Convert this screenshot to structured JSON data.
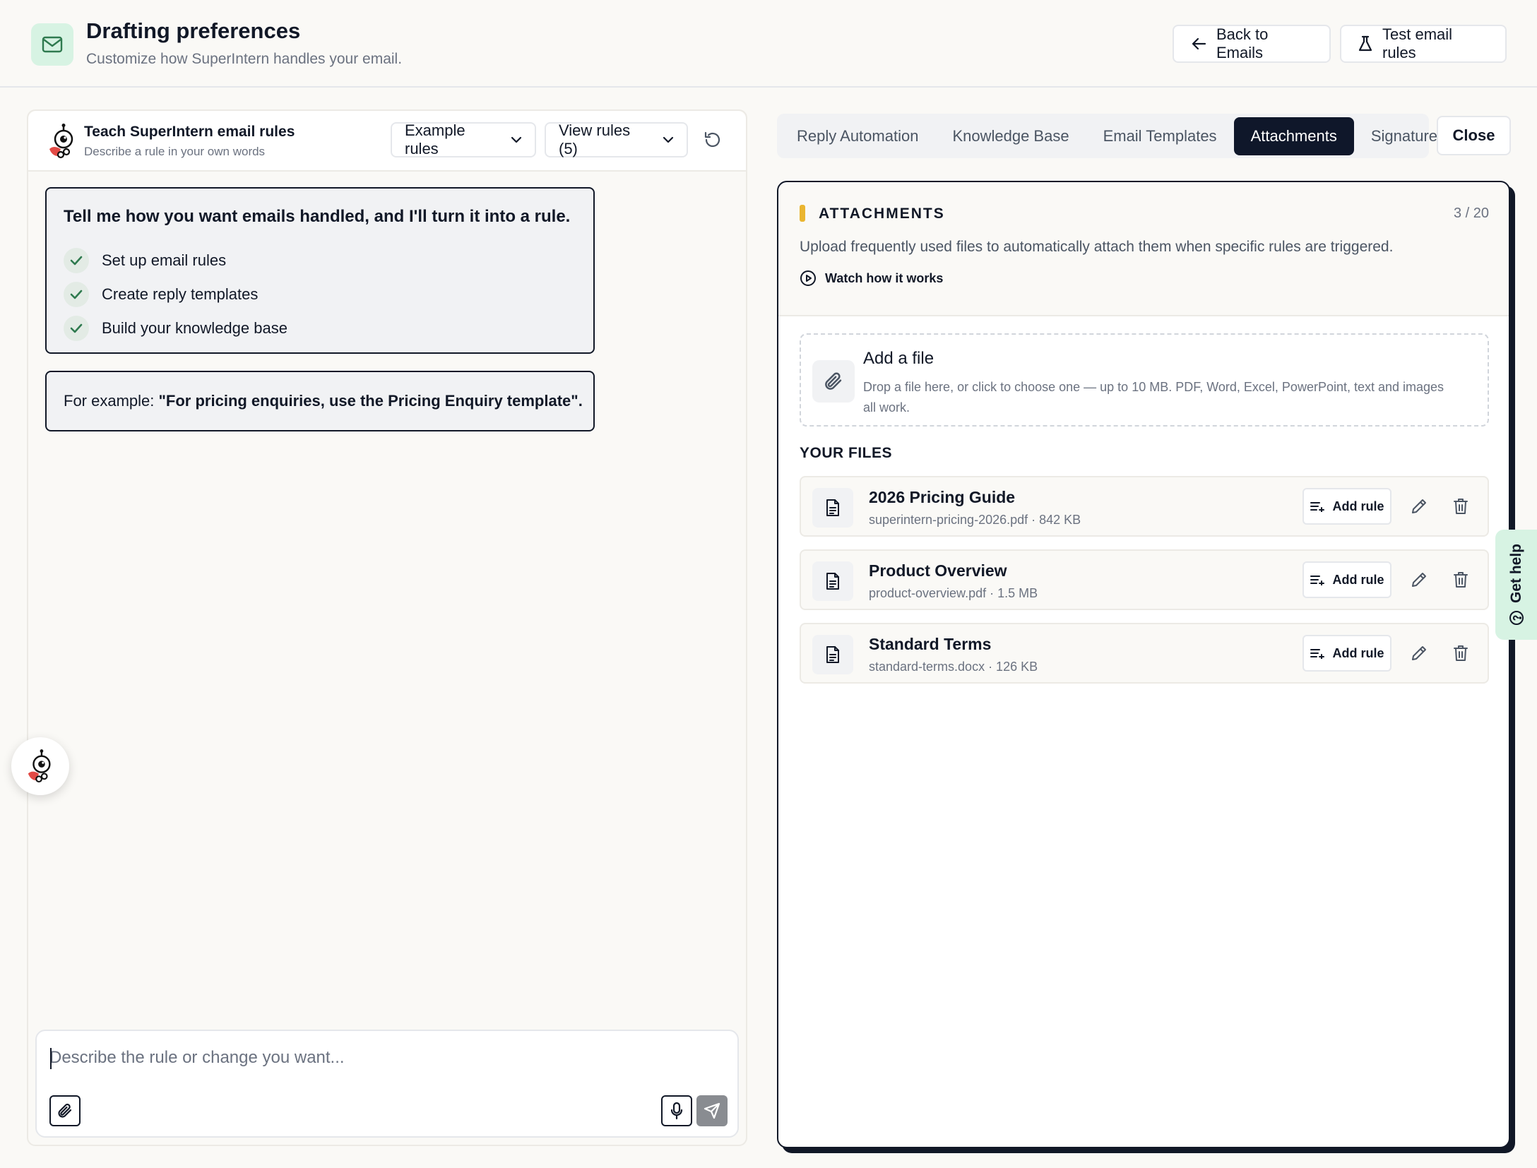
{
  "header": {
    "title": "Drafting preferences",
    "subtitle": "Customize how SuperIntern handles your email.",
    "back_label": "Back to Emails",
    "test_label": "Test email rules"
  },
  "left_panel": {
    "title": "Teach SuperIntern email rules",
    "subtitle": "Describe a rule in your own words",
    "examples_label": "Example rules",
    "view_rules_label": "View rules (5)",
    "intro_title": "Tell me how you want emails handled, and I'll turn it into a rule.",
    "checklist": [
      {
        "label": "Set up email rules"
      },
      {
        "label": "Create reply templates"
      },
      {
        "label": "Build your knowledge base"
      }
    ],
    "example_prefix": "For example: ",
    "example_bold": "\"For pricing enquiries, use the Pricing Enquiry template\".",
    "composer_placeholder": "Describe the rule or change you want..."
  },
  "tabs": [
    {
      "label": "Reply Automation",
      "active": false
    },
    {
      "label": "Knowledge Base",
      "active": false
    },
    {
      "label": "Email Templates",
      "active": false
    },
    {
      "label": "Attachments",
      "active": true
    },
    {
      "label": "Signature",
      "active": false
    }
  ],
  "close_label": "Close",
  "attachments": {
    "heading": "ATTACHMENTS",
    "count": "3 / 20",
    "description": "Upload frequently used files to automatically attach them when specific rules are triggered.",
    "watch_label": "Watch how it works",
    "dropzone_title": "Add a file",
    "dropzone_subtitle": "Drop a file here, or click to choose one — up to 10 MB. PDF, Word, Excel, PowerPoint, text and images all work.",
    "files_label": "YOUR FILES",
    "add_rule_label": "Add rule",
    "files": [
      {
        "name": "2026 Pricing Guide",
        "meta": "superintern-pricing-2026.pdf · 842 KB"
      },
      {
        "name": "Product Overview",
        "meta": "product-overview.pdf · 1.5 MB"
      },
      {
        "name": "Standard Terms",
        "meta": "standard-terms.docx · 126 KB"
      }
    ]
  },
  "get_help_label": "Get help",
  "colors": {
    "accent_green": "#d7f3e3",
    "active_tab": "#0f172a",
    "accent_yellow": "#eab530"
  }
}
